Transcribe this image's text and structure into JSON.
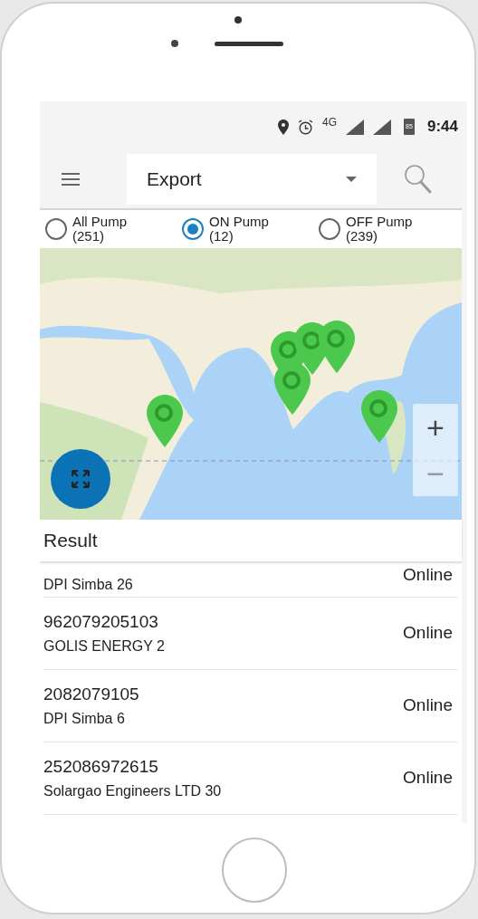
{
  "status_bar": {
    "network": "4G",
    "battery": "85",
    "time": "9:44"
  },
  "toolbar": {
    "dropdown": {
      "value": "Export"
    }
  },
  "filters": [
    {
      "label": "All Pump",
      "count": "(251)",
      "selected": false
    },
    {
      "label": "ON Pump",
      "count": "(12)",
      "selected": true
    },
    {
      "label": "OFF Pump",
      "count": "(239)",
      "selected": false
    }
  ],
  "map": {
    "zoom_in": "+",
    "zoom_out": "−"
  },
  "result": {
    "title": "Result",
    "rows": [
      {
        "id": "",
        "name": "DPI Simba 26",
        "status": "Online"
      },
      {
        "id": "962079205103",
        "name": "GOLIS ENERGY 2",
        "status": "Online"
      },
      {
        "id": "2082079105",
        "name": "DPI Simba 6",
        "status": "Online"
      },
      {
        "id": "252086972615",
        "name": "Solargao Engineers LTD 30",
        "status": "Online"
      }
    ]
  }
}
